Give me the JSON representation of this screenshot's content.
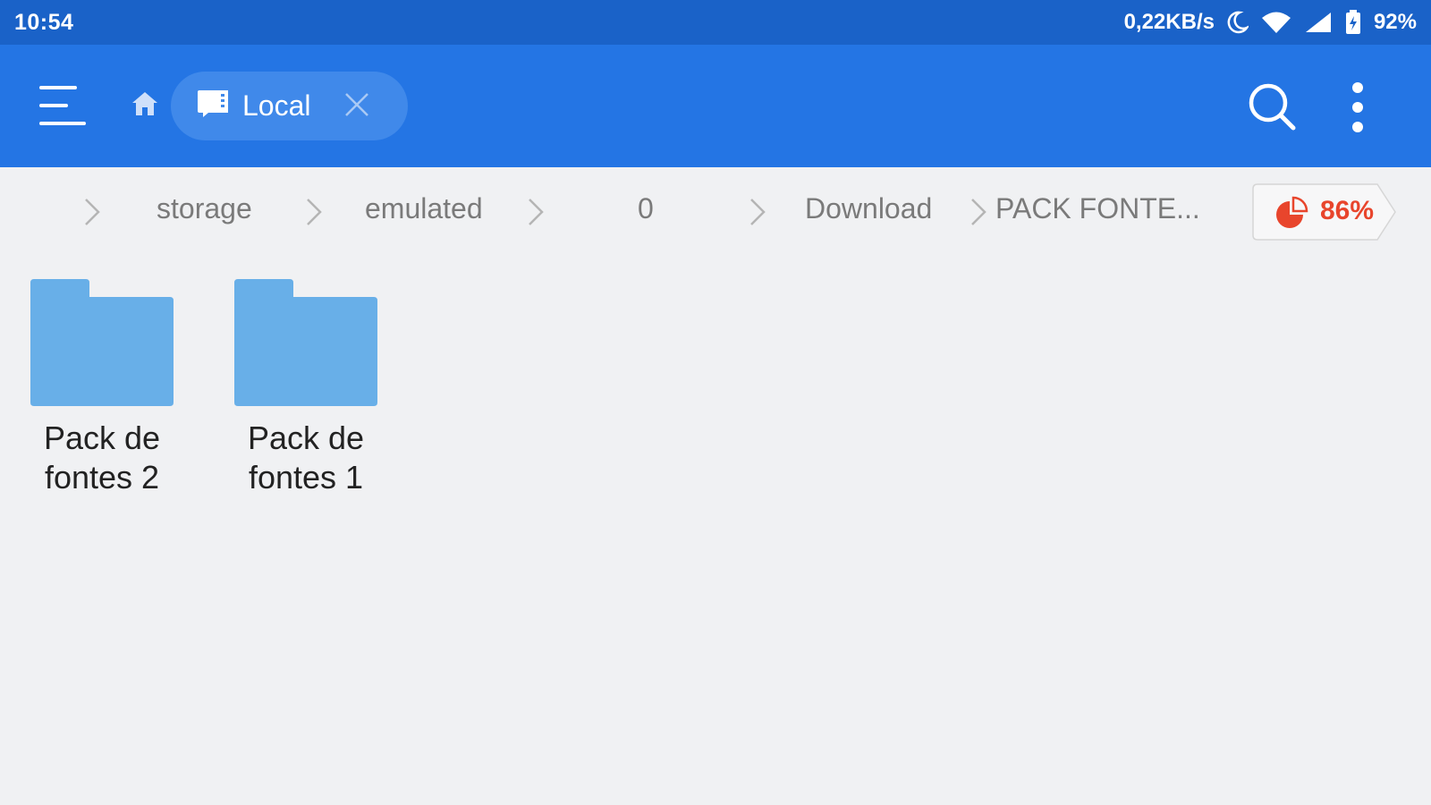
{
  "status_bar": {
    "time": "10:54",
    "network_speed": "0,22KB/s",
    "battery": "92%"
  },
  "app_bar": {
    "tab_label": "Local",
    "icons": [
      "menu-icon",
      "home-icon",
      "sd-card-icon",
      "close-icon",
      "search-icon",
      "more-vertical-icon"
    ]
  },
  "breadcrumb": {
    "items": [
      "storage",
      "emulated",
      "0",
      "Download",
      "PACK FONTE..."
    ],
    "storage_usage": "86%"
  },
  "folders": [
    {
      "name": "Pack de fontes 2",
      "icon": "folder-icon"
    },
    {
      "name": "Pack de fontes 1",
      "icon": "folder-icon"
    }
  ],
  "colors": {
    "status_bar": "#1a62c8",
    "app_bar": "#2475e4",
    "tab_bg": "#4089ea",
    "folder": "#68afe8",
    "usage_accent": "#e8452c",
    "background": "#f0f1f3"
  }
}
